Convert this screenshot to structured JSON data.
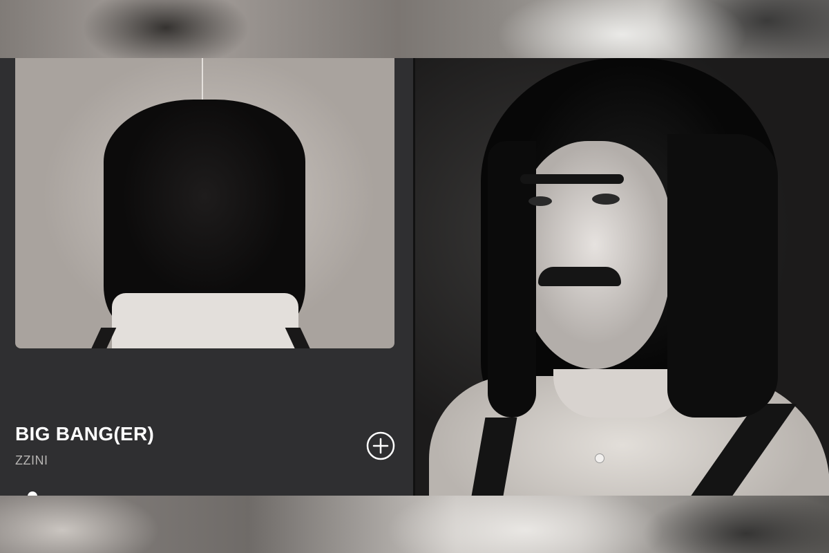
{
  "now_playing": {
    "title": "BIG BANG(ER)",
    "artist": "ZZINI",
    "add_icon": "plus-circle-icon"
  },
  "colors": {
    "panel_background": "#2f2f31",
    "title_text": "#ffffff",
    "artist_text": "#b8b6b4"
  }
}
